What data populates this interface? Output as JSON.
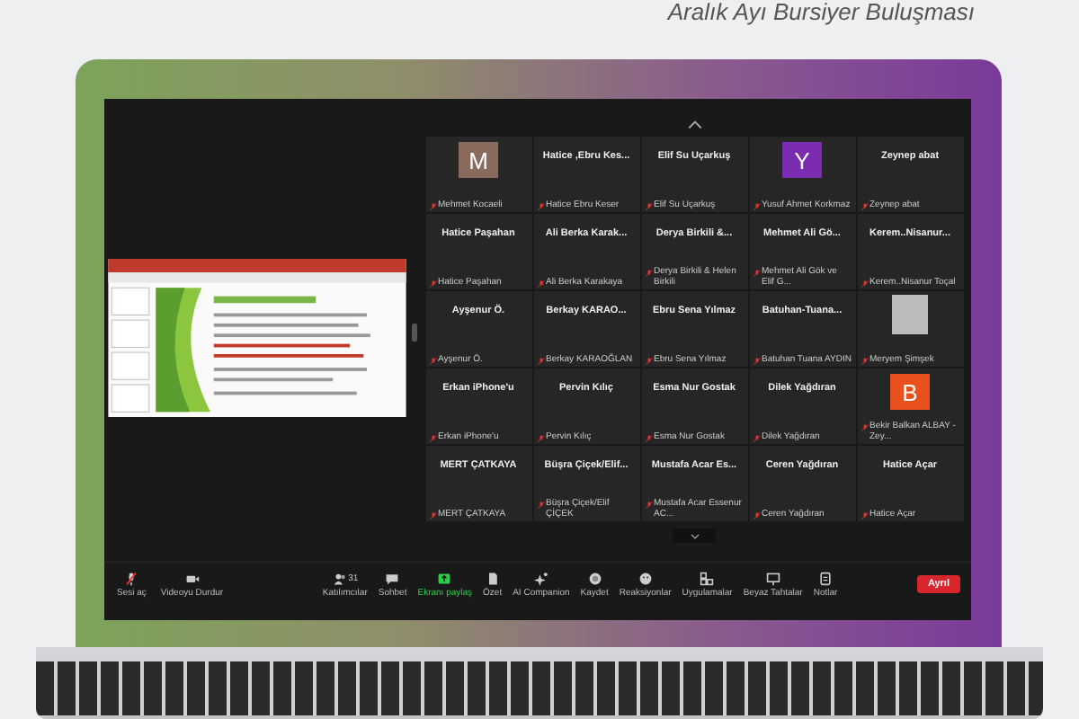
{
  "caption": "Aralık Ayı Bursiyer Buluşması",
  "gallery": {
    "tiles": [
      {
        "kind": "avatar",
        "initial": "M",
        "color": "#8a6a5c",
        "label": "Mehmet Kocaeli",
        "muted": true
      },
      {
        "kind": "name",
        "name": "Hatice ,Ebru Kes...",
        "label": "Hatice Ebru Keser",
        "muted": true
      },
      {
        "kind": "name",
        "name": "Elif Su Uçarkuş",
        "label": "Elif Su Uçarkuş",
        "muted": true
      },
      {
        "kind": "avatar",
        "initial": "Y",
        "color": "#7a2bb0",
        "label": "Yusuf Ahmet Korkmaz",
        "muted": true
      },
      {
        "kind": "name",
        "name": "Zeynep abat",
        "label": "Zeynep abat",
        "muted": true
      },
      {
        "kind": "name",
        "name": "Hatice Paşahan",
        "label": "Hatice Paşahan",
        "muted": true
      },
      {
        "kind": "name",
        "name": "Ali Berka Karak...",
        "label": "Ali Berka Karakaya",
        "muted": true
      },
      {
        "kind": "name",
        "name": "Derya Birkili &...",
        "label": "Derya Birkili & Helen Birkili",
        "muted": true
      },
      {
        "kind": "name",
        "name": "Mehmet Ali Gö...",
        "label": "Mehmet Ali Gök ve Elif G...",
        "muted": true
      },
      {
        "kind": "name",
        "name": "Kerem..Nisanur...",
        "label": "Kerem..Nisanur Toçal",
        "muted": true
      },
      {
        "kind": "name",
        "name": "Ayşenur Ö.",
        "label": "Ayşenur Ö.",
        "muted": true
      },
      {
        "kind": "name",
        "name": "Berkay KARAO...",
        "label": "Berkay KARAOĞLAN",
        "muted": true
      },
      {
        "kind": "name",
        "name": "Ebru Sena Yılmaz",
        "label": "Ebru Sena Yılmaz",
        "muted": true
      },
      {
        "kind": "name",
        "name": "Batuhan-Tuana...",
        "label": "Batuhan Tuana AYDIN",
        "muted": true
      },
      {
        "kind": "photo",
        "label": "Meryem Şimşek",
        "muted": true
      },
      {
        "kind": "name",
        "name": "Erkan iPhone'u",
        "label": "Erkan iPhone'u",
        "muted": true
      },
      {
        "kind": "name",
        "name": "Pervin Kılıç",
        "label": "Pervin Kılıç",
        "muted": true
      },
      {
        "kind": "name",
        "name": "Esma Nur Gostak",
        "label": "Esma Nur Gostak",
        "muted": true
      },
      {
        "kind": "name",
        "name": "Dilek Yağdıran",
        "label": "Dilek Yağdıran",
        "muted": true
      },
      {
        "kind": "avatar",
        "initial": "B",
        "color": "#e8501c",
        "label": "Bekir Balkan ALBAY - Zey...",
        "muted": true
      },
      {
        "kind": "name",
        "name": "MERT ÇATKAYA",
        "label": "MERT ÇATKAYA",
        "muted": true
      },
      {
        "kind": "name",
        "name": "Büşra Çiçek/Elif...",
        "label": "Büşra Çiçek/Elif ÇİÇEK",
        "muted": true
      },
      {
        "kind": "name",
        "name": "Mustafa Acar Es...",
        "label": "Mustafa Acar Essenur AC...",
        "muted": true
      },
      {
        "kind": "name",
        "name": "Ceren Yağdıran",
        "label": "Ceren Yağdıran",
        "muted": true
      },
      {
        "kind": "name",
        "name": "Hatice Açar",
        "label": "Hatice Açar",
        "muted": true
      }
    ]
  },
  "toolbar": {
    "left": [
      {
        "label": "Sesi aç",
        "muted": true
      },
      {
        "label": "Videoyu Durdur"
      }
    ],
    "center": [
      {
        "label": "Katılımcılar",
        "count": "31",
        "selected": false
      },
      {
        "label": "Sohbet",
        "selected": false
      },
      {
        "label": "Ekranı paylaş",
        "selected": true
      },
      {
        "label": "Özet",
        "selected": false
      },
      {
        "label": "AI Companion",
        "selected": false
      },
      {
        "label": "Kaydet",
        "selected": false
      },
      {
        "label": "Reaksiyonlar",
        "selected": false
      },
      {
        "label": "Uygulamalar",
        "selected": false
      },
      {
        "label": "Beyaz Tahtalar",
        "selected": false
      },
      {
        "label": "Notlar",
        "selected": false
      }
    ],
    "leave": "Ayrıl"
  }
}
